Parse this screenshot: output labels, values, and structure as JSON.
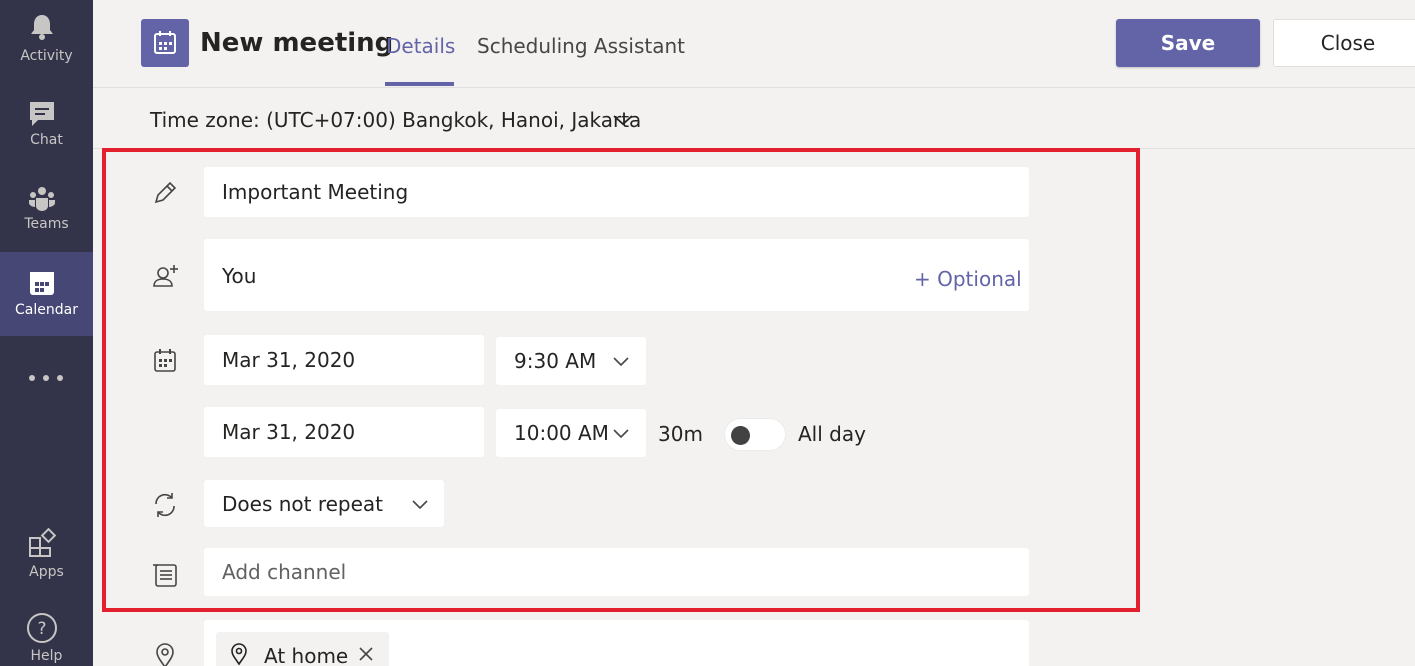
{
  "rail": {
    "items": [
      {
        "label": "Activity",
        "icon": "bell-icon"
      },
      {
        "label": "Chat",
        "icon": "chat-icon"
      },
      {
        "label": "Teams",
        "icon": "teams-icon"
      },
      {
        "label": "Calendar",
        "icon": "calendar-icon",
        "active": true
      },
      {
        "label": "Apps",
        "icon": "apps-icon"
      },
      {
        "label": "Help",
        "icon": "help-icon"
      }
    ]
  },
  "header": {
    "title": "New meeting",
    "tabs": [
      {
        "label": "Details",
        "active": true
      },
      {
        "label": "Scheduling Assistant"
      }
    ],
    "save_label": "Save",
    "close_label": "Close"
  },
  "timezone": {
    "label": "Time zone: (UTC+07:00) Bangkok, Hanoi, Jakarta"
  },
  "form": {
    "title_value": "Important Meeting",
    "attendees_value": "You",
    "optional_label": "+ Optional",
    "start_date": "Mar 31, 2020",
    "start_time": "9:30 AM",
    "end_date": "Mar 31, 2020",
    "end_time": "10:00 AM",
    "duration": "30m",
    "all_day_label": "All day",
    "repeat_value": "Does not repeat",
    "channel_placeholder": "Add channel",
    "location_chip": "At home"
  },
  "colors": {
    "accent": "#6264a7",
    "rail_bg": "#33344a",
    "highlight": "#e3202d"
  }
}
